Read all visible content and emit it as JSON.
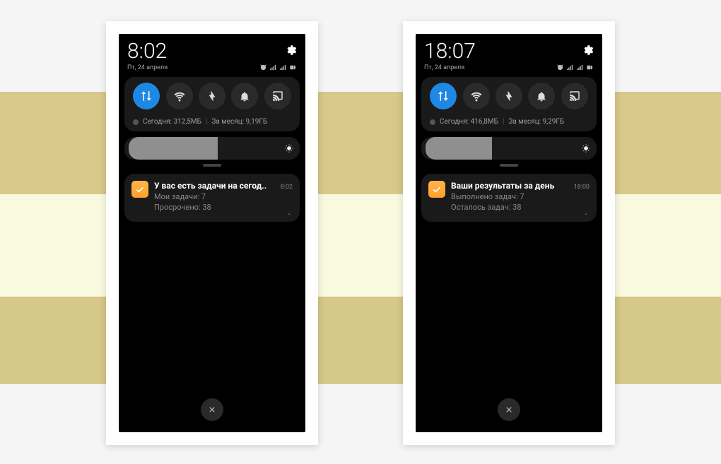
{
  "phone1": {
    "clock": "8:02",
    "date": "Пт, 24 апреля",
    "data_today": "Сегодня: 312,5МБ",
    "data_month": "За месяц: 9,19ГБ",
    "brightness_pct": 55,
    "notif": {
      "title": "У вас есть задачи на сегод..",
      "time": "8:02",
      "line1": "Мои задачи: 7",
      "line2": "Просрочено: 38"
    }
  },
  "phone2": {
    "clock": "18:07",
    "date": "Пт, 24 апреля",
    "data_today": "Сегодня: 416,8МБ",
    "data_month": "За месяц: 9,29ГБ",
    "brightness_pct": 38,
    "notif": {
      "title": "Ваши результаты за день",
      "time": "18:00",
      "line1": "Выполнено задач: 7",
      "line2": "Осталось задач: 38"
    }
  }
}
